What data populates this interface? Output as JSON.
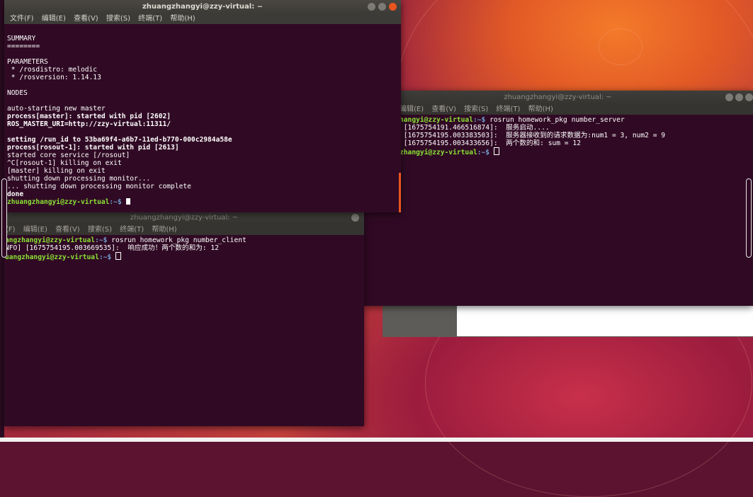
{
  "colors": {
    "terminal_bg": "#300a24",
    "prompt_user": "#8ae234",
    "prompt_path": "#729fcf",
    "ubuntu_orange": "#e95420"
  },
  "win_main": {
    "title": "zhuangzhangyi@zzy-virtual: ~",
    "menu": [
      "文件(F)",
      "编辑(E)",
      "查看(V)",
      "搜索(S)",
      "终端(T)",
      "帮助(H)"
    ],
    "lines": {
      "l1": "SUMMARY",
      "l2": "========",
      "l3": "PARAMETERS",
      "l4": " * /rosdistro: melodic",
      "l5": " * /rosversion: 1.14.13",
      "l6": "NODES",
      "l7": "auto-starting new master",
      "l8": "process[master]: started with pid [2602]",
      "l9": "ROS_MASTER_URI=http://zzy-virtual:11311/",
      "l10": "setting /run_id to 53ba69f4-a6b7-11ed-b770-000c2984a58e",
      "l11": "process[rosout-1]: started with pid [2613]",
      "l12": "started core service [/rosout]",
      "l13": "^C[rosout-1] killing on exit",
      "l14": "[master] killing on exit",
      "l15": "shutting down processing monitor...",
      "l16": "... shutting down processing monitor complete",
      "l17": "done"
    },
    "prompt_user": "zhuangzhangyi@zzy-virtual",
    "prompt_path": ":~$"
  },
  "win_client": {
    "title": "zhuangzhangyi@zzy-virtual: ~",
    "menu": [
      "(F)",
      "编辑(E)",
      "查看(V)",
      "搜索(S)",
      "终端(T)",
      "帮助(H)"
    ],
    "prompt1_user": "angzhangyi@zzy-virtual",
    "prompt1_path": ":~$",
    "cmd": " rosrun homework_pkg number_client",
    "out": "NFO] [1675754195.003669535]:  响应成功！两个数的和为: 12",
    "prompt2_user": "uangzhangyi@zzy-virtual",
    "prompt2_path": ":~$"
  },
  "win_server": {
    "title": "zhuangzhangyi@zzy-virtual: ~",
    "menu": [
      "编辑(E)",
      "查看(V)",
      "搜索(S)",
      "终端(T)",
      "帮助(H)"
    ],
    "prompt1_user": "hangyi@zzy-virtual",
    "prompt1_path": ":~$",
    "cmd": " rosrun homework_pkg number_server",
    "out1": " [1675754191.466516874]:  服务启动....",
    "out2": " [1675754195.003383503]:  服务器接收到的请求数据为:num1 = 3, num2 = 9",
    "out3": " [1675754195.003433656]:  两个数的和: sum = 12",
    "prompt2_user": "zhangyi@zzy-virtual",
    "prompt2_path": ":~$"
  }
}
